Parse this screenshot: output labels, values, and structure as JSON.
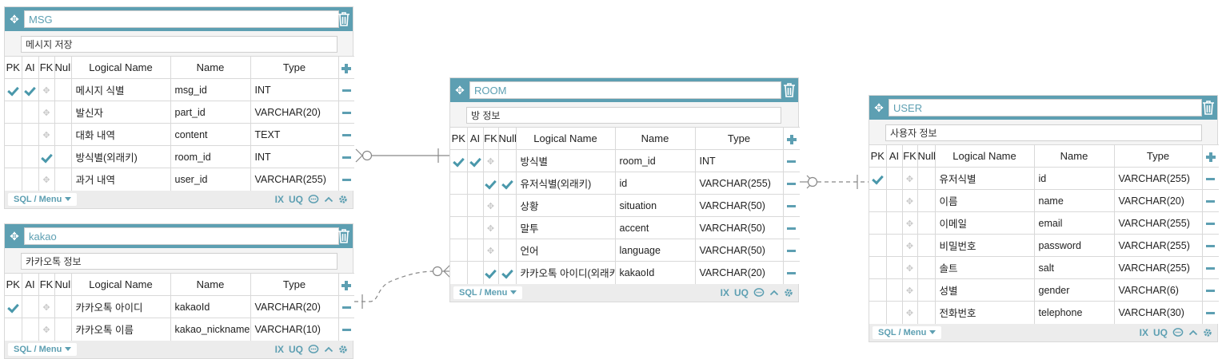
{
  "columns_header": {
    "pk": "PK",
    "ai": "AI",
    "fk": "FK",
    "null": "Null",
    "logical": "Logical Name",
    "name": "Name",
    "type": "Type"
  },
  "footer": {
    "menu_label": "SQL / Menu",
    "index_label": "IX",
    "unique_label": "UQ"
  },
  "icons": {
    "move": "move-icon",
    "delete": "trash-icon",
    "add": "plus-icon",
    "remove": "minus-icon",
    "comment": "comment-icon",
    "collapse": "chevron-up-icon",
    "settings": "gear-icon",
    "check": "check-icon",
    "drag": "drag-handle-icon"
  },
  "colors": {
    "header": "#5d9fb2",
    "accent": "#4a98ab",
    "panel": "#f4f4f4",
    "relation_line": "#888888"
  },
  "tables": {
    "msg": {
      "name": "MSG",
      "comment": "메시지 저장",
      "columns": [
        {
          "pk": true,
          "ai": true,
          "fk": false,
          "null": false,
          "logical": "메시지 식별",
          "name": "msg_id",
          "type": "INT"
        },
        {
          "pk": false,
          "ai": false,
          "fk": false,
          "null": false,
          "logical": "발신자",
          "name": "part_id",
          "type": "VARCHAR(20)"
        },
        {
          "pk": false,
          "ai": false,
          "fk": false,
          "null": false,
          "logical": "대화 내역",
          "name": "content",
          "type": "TEXT"
        },
        {
          "pk": false,
          "ai": false,
          "fk": true,
          "null": false,
          "logical": "방식별(외래키)",
          "name": "room_id",
          "type": "INT"
        },
        {
          "pk": false,
          "ai": false,
          "fk": false,
          "null": false,
          "logical": "과거 내역",
          "name": "user_id",
          "type": "VARCHAR(255)"
        }
      ]
    },
    "kakao": {
      "name": "kakao",
      "comment": "카카오톡 정보",
      "columns": [
        {
          "pk": true,
          "ai": false,
          "fk": false,
          "null": false,
          "logical": "카카오톡 아이디",
          "name": "kakaoId",
          "type": "VARCHAR(20)"
        },
        {
          "pk": false,
          "ai": false,
          "fk": false,
          "null": false,
          "logical": "카카오톡 이름",
          "name": "kakao_nickname",
          "type": "VARCHAR(10)"
        }
      ]
    },
    "room": {
      "name": "ROOM",
      "comment": "방 정보",
      "columns": [
        {
          "pk": true,
          "ai": true,
          "fk": false,
          "null": false,
          "logical": "방식별",
          "name": "room_id",
          "type": "INT"
        },
        {
          "pk": false,
          "ai": false,
          "fk": true,
          "null": true,
          "logical": "유저식별(외래키)",
          "name": "id",
          "type": "VARCHAR(255)"
        },
        {
          "pk": false,
          "ai": false,
          "fk": false,
          "null": false,
          "logical": "상황",
          "name": "situation",
          "type": "VARCHAR(50)"
        },
        {
          "pk": false,
          "ai": false,
          "fk": false,
          "null": false,
          "logical": "말투",
          "name": "accent",
          "type": "VARCHAR(50)"
        },
        {
          "pk": false,
          "ai": false,
          "fk": false,
          "null": false,
          "logical": "언어",
          "name": "language",
          "type": "VARCHAR(50)"
        },
        {
          "pk": false,
          "ai": false,
          "fk": true,
          "null": true,
          "logical": "카카오톡 아이디(외래키)",
          "name": "kakaoId",
          "type": "VARCHAR(20)"
        }
      ]
    },
    "user": {
      "name": "USER",
      "comment": "사용자 정보",
      "columns": [
        {
          "pk": true,
          "ai": false,
          "fk": false,
          "null": false,
          "logical": "유저식별",
          "name": "id",
          "type": "VARCHAR(255)"
        },
        {
          "pk": false,
          "ai": false,
          "fk": false,
          "null": false,
          "logical": "이름",
          "name": "name",
          "type": "VARCHAR(20)"
        },
        {
          "pk": false,
          "ai": false,
          "fk": false,
          "null": false,
          "logical": "이메일",
          "name": "email",
          "type": "VARCHAR(255)"
        },
        {
          "pk": false,
          "ai": false,
          "fk": false,
          "null": false,
          "logical": "비밀번호",
          "name": "password",
          "type": "VARCHAR(255)"
        },
        {
          "pk": false,
          "ai": false,
          "fk": false,
          "null": false,
          "logical": "솔트",
          "name": "salt",
          "type": "VARCHAR(255)"
        },
        {
          "pk": false,
          "ai": false,
          "fk": false,
          "null": false,
          "logical": "성별",
          "name": "gender",
          "type": "VARCHAR(6)"
        },
        {
          "pk": false,
          "ai": false,
          "fk": false,
          "null": false,
          "logical": "전화번호",
          "name": "telephone",
          "type": "VARCHAR(30)"
        }
      ]
    }
  },
  "relations": [
    {
      "from": "room",
      "to": "msg",
      "style": "solid",
      "to_end": "zero-or-many"
    },
    {
      "from": "kakao",
      "to": "room",
      "style": "dashed",
      "to_end": "zero-or-many"
    },
    {
      "from": "user",
      "to": "room",
      "style": "dashed",
      "to_end": "zero-or-many"
    }
  ]
}
